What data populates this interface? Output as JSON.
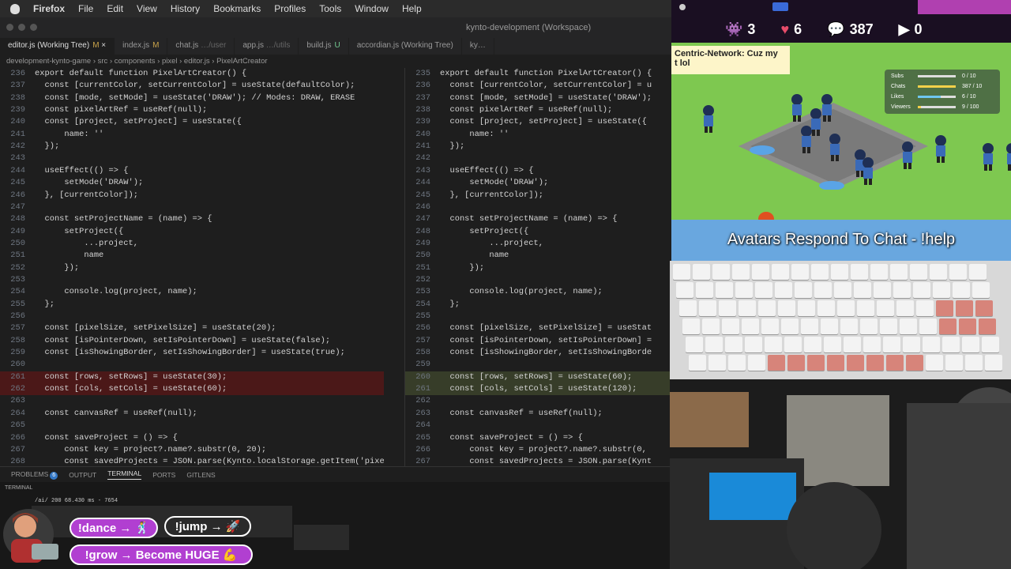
{
  "menubar": {
    "app": "Firefox",
    "items": [
      "File",
      "Edit",
      "View",
      "History",
      "Bookmarks",
      "Profiles",
      "Tools",
      "Window",
      "Help"
    ]
  },
  "window": {
    "title": "kynto-development (Workspace)"
  },
  "tabs": [
    {
      "label": "editor.js (Working Tree)",
      "flag": "M",
      "active": true
    },
    {
      "label": "index.js",
      "flag": "M"
    },
    {
      "label": "chat.js",
      "sub": "…/user",
      "flag": ""
    },
    {
      "label": "app.js",
      "sub": "…/utils",
      "flag": ""
    },
    {
      "label": "build.js",
      "flag": "U"
    },
    {
      "label": "accordian.js (Working Tree)",
      "flag": ""
    },
    {
      "label": "ky…",
      "flag": ""
    }
  ],
  "breadcrumb": "development-kynto-game  ›  src  ›  components  ›  pixel  ›  editor.js  ›  PixelArtCreator",
  "editor_left": [
    {
      "n": "236",
      "t": "export default function PixelArtCreator() {"
    },
    {
      "n": "237",
      "t": "  const [currentColor, setCurrentColor] = useState(defaultColor);"
    },
    {
      "n": "238",
      "t": "  const [mode, setMode] = useState('DRAW'); // Modes: DRAW, ERASE"
    },
    {
      "n": "239",
      "t": "  const pixelArtRef = useRef(null);"
    },
    {
      "n": "240",
      "t": "  const [project, setProject] = useState({"
    },
    {
      "n": "241",
      "t": "      name: ''"
    },
    {
      "n": "242",
      "t": "  });"
    },
    {
      "n": "243",
      "t": ""
    },
    {
      "n": "244",
      "t": "  useEffect(() => {"
    },
    {
      "n": "245",
      "t": "      setMode('DRAW');"
    },
    {
      "n": "246",
      "t": "  }, [currentColor]);"
    },
    {
      "n": "247",
      "t": ""
    },
    {
      "n": "248",
      "t": "  const setProjectName = (name) => {"
    },
    {
      "n": "249",
      "t": "      setProject({"
    },
    {
      "n": "250",
      "t": "          ...project,"
    },
    {
      "n": "251",
      "t": "          name"
    },
    {
      "n": "252",
      "t": "      });"
    },
    {
      "n": "253",
      "t": ""
    },
    {
      "n": "254",
      "t": "      console.log(project, name);"
    },
    {
      "n": "255",
      "t": "  };"
    },
    {
      "n": "256",
      "t": ""
    },
    {
      "n": "257",
      "t": "  const [pixelSize, setPixelSize] = useState(20);"
    },
    {
      "n": "258",
      "t": "  const [isPointerDown, setIsPointerDown] = useState(false);"
    },
    {
      "n": "259",
      "t": "  const [isShowingBorder, setIsShowingBorder] = useState(true);"
    },
    {
      "n": "260",
      "t": ""
    },
    {
      "n": "261",
      "t": "  const [rows, setRows] = useState(30);",
      "diff": "del"
    },
    {
      "n": "262",
      "t": "  const [cols, setCols] = useState(60);",
      "diff": "del"
    },
    {
      "n": "263",
      "t": ""
    },
    {
      "n": "264",
      "t": "  const canvasRef = useRef(null);"
    },
    {
      "n": "265",
      "t": ""
    },
    {
      "n": "266",
      "t": "  const saveProject = () => {"
    },
    {
      "n": "267",
      "t": "      const key = project?.name?.substr(0, 20);"
    },
    {
      "n": "268",
      "t": "      const savedProjects = JSON.parse(Kynto.localStorage.getItem('pixe"
    }
  ],
  "editor_right": [
    {
      "n": "235",
      "t": "export default function PixelArtCreator() {"
    },
    {
      "n": "236",
      "t": "  const [currentColor, setCurrentColor] = u"
    },
    {
      "n": "237",
      "t": "  const [mode, setMode] = useState('DRAW');"
    },
    {
      "n": "238",
      "t": "  const pixelArtRef = useRef(null);"
    },
    {
      "n": "239",
      "t": "  const [project, setProject] = useState({"
    },
    {
      "n": "240",
      "t": "      name: ''"
    },
    {
      "n": "241",
      "t": "  });"
    },
    {
      "n": "242",
      "t": ""
    },
    {
      "n": "243",
      "t": "  useEffect(() => {"
    },
    {
      "n": "244",
      "t": "      setMode('DRAW');"
    },
    {
      "n": "245",
      "t": "  }, [currentColor]);"
    },
    {
      "n": "246",
      "t": ""
    },
    {
      "n": "247",
      "t": "  const setProjectName = (name) => {"
    },
    {
      "n": "248",
      "t": "      setProject({"
    },
    {
      "n": "249",
      "t": "          ...project,"
    },
    {
      "n": "250",
      "t": "          name"
    },
    {
      "n": "251",
      "t": "      });"
    },
    {
      "n": "252",
      "t": ""
    },
    {
      "n": "253",
      "t": "      console.log(project, name);"
    },
    {
      "n": "254",
      "t": "  };"
    },
    {
      "n": "255",
      "t": ""
    },
    {
      "n": "256",
      "t": "  const [pixelSize, setPixelSize] = useStat"
    },
    {
      "n": "257",
      "t": "  const [isPointerDown, setIsPointerDown] ="
    },
    {
      "n": "258",
      "t": "  const [isShowingBorder, setIsShowingBorde"
    },
    {
      "n": "259",
      "t": ""
    },
    {
      "n": "260",
      "t": "  const [rows, setRows] = useState(60);",
      "diff": "add"
    },
    {
      "n": "261",
      "t": "  const [cols, setCols] = useState(120);",
      "diff": "add"
    },
    {
      "n": "262",
      "t": ""
    },
    {
      "n": "263",
      "t": "  const canvasRef = useRef(null);"
    },
    {
      "n": "264",
      "t": ""
    },
    {
      "n": "265",
      "t": "  const saveProject = () => {"
    },
    {
      "n": "266",
      "t": "      const key = project?.name?.substr(0,"
    },
    {
      "n": "267",
      "t": "      const savedProjects = JSON.parse(Kynt"
    }
  ],
  "panel": {
    "problems": "PROBLEMS",
    "problems_count": "6",
    "output": "OUTPUT",
    "terminal": "TERMINAL",
    "ports": "PORTS",
    "gitlens": "GITLENS"
  },
  "terminal": {
    "label": "TERMINAL",
    "line1": "/ai/ 200 68.430 ms - 7654"
  },
  "commands": {
    "dance": "!dance → 🕺",
    "jump": "!jump → 🚀",
    "grow": "!grow → Become HUGE 💪"
  },
  "stream": {
    "stats": {
      "bots": "3",
      "hearts": "6",
      "chats": "387",
      "yt": "0"
    },
    "chat_bubble": "Centric-Network: Cuz my\nt lol",
    "goals": [
      {
        "label": "Subs",
        "value": "0 / 10",
        "frac": 0.0
      },
      {
        "label": "Chats",
        "value": "387 / 10",
        "frac": 1.0
      },
      {
        "label": "Likes",
        "value": "6 / 10",
        "frac": 0.6
      },
      {
        "label": "Viewers",
        "value": "9 / 100",
        "frac": 0.09
      }
    ],
    "caption": "Avatars Respond To Chat - !help",
    "colors": {
      "goal_fill": "#f4d04a",
      "likes_fill": "#6ec6f0",
      "badge": "#c040c0"
    }
  }
}
